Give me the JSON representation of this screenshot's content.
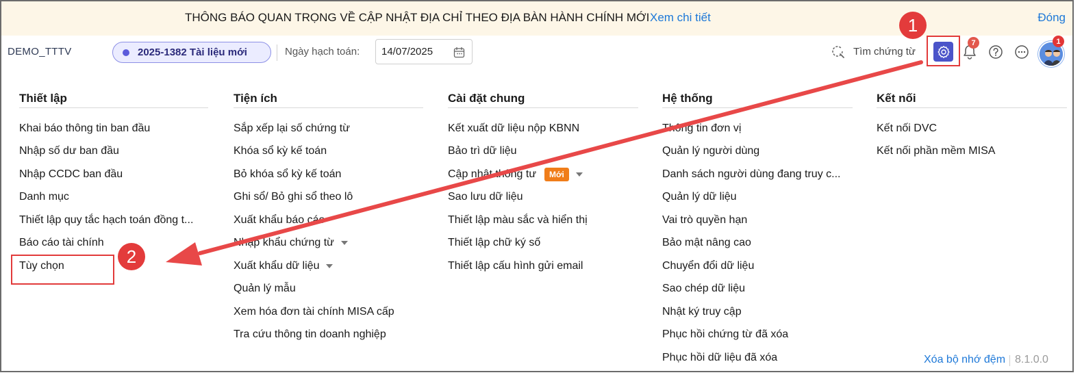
{
  "notice": {
    "text": "THÔNG BÁO QUAN TRỌNG VỀ CẬP NHẬT ĐỊA CHỈ THEO ĐỊA BÀN HÀNH CHÍNH MỚI",
    "link": "Xem chi tiết",
    "close": "Đóng"
  },
  "header": {
    "db_name": "DEMO_TTTV",
    "document": "2025-1382 Tài liệu mới",
    "date_label": "Ngày hạch toán:",
    "date_value": "14/07/2025",
    "search_label": "Tìm chứng từ",
    "notification_count": "7",
    "avatar_count": "1"
  },
  "callouts": {
    "one": "1",
    "two": "2"
  },
  "columns": [
    {
      "title": "Thiết lập",
      "items": [
        {
          "label": "Khai báo thông tin ban đầu"
        },
        {
          "label": "Nhập số dư ban đầu"
        },
        {
          "label": "Nhập CCDC ban đầu"
        },
        {
          "label": "Danh mục"
        },
        {
          "label": "Thiết lập quy tắc hạch toán đồng t..."
        },
        {
          "label": "Báo cáo tài chính"
        },
        {
          "label": "Tùy chọn"
        }
      ]
    },
    {
      "title": "Tiện ích",
      "items": [
        {
          "label": "Sắp xếp lại số chứng từ"
        },
        {
          "label": "Khóa sổ kỳ kế toán"
        },
        {
          "label": "Bỏ khóa sổ kỳ kế toán"
        },
        {
          "label": "Ghi sổ/ Bỏ ghi sổ theo lô"
        },
        {
          "label": "Xuất khẩu báo cáo"
        },
        {
          "label": "Nhập khẩu chứng từ",
          "caret": true
        },
        {
          "label": "Xuất khẩu dữ liệu",
          "caret": true
        },
        {
          "label": "Quản lý mẫu"
        },
        {
          "label": "Xem hóa đơn tài chính MISA cấp"
        },
        {
          "label": "Tra cứu thông tin doanh nghiệp"
        }
      ]
    },
    {
      "title": "Cài đặt chung",
      "items": [
        {
          "label": "Kết xuất dữ liệu nộp KBNN"
        },
        {
          "label": "Bảo trì dữ liệu"
        },
        {
          "label": "Cập nhật thông tư",
          "badge": "Mới",
          "caret": true
        },
        {
          "label": "Sao lưu dữ liệu"
        },
        {
          "label": "Thiết lập màu sắc và hiển thị"
        },
        {
          "label": "Thiết lập chữ ký số"
        },
        {
          "label": "Thiết lập cấu hình gửi email"
        }
      ]
    },
    {
      "title": "Hệ thống",
      "items": [
        {
          "label": "Thông tin đơn vị"
        },
        {
          "label": "Quản lý người dùng"
        },
        {
          "label": "Danh sách người dùng đang truy c..."
        },
        {
          "label": "Quản lý dữ liệu"
        },
        {
          "label": "Vai trò quyền hạn"
        },
        {
          "label": "Bảo mật nâng cao"
        },
        {
          "label": "Chuyển đổi dữ liệu"
        },
        {
          "label": "Sao chép dữ liệu"
        },
        {
          "label": "Nhật ký truy cập"
        },
        {
          "label": "Phục hồi chứng từ đã xóa"
        },
        {
          "label": "Phục hồi dữ liệu đã xóa"
        }
      ]
    },
    {
      "title": "Kết nối",
      "items": [
        {
          "label": "Kết nối DVC"
        },
        {
          "label": "Kết nối phần mềm MISA"
        }
      ]
    }
  ],
  "footer": {
    "clear_cache": "Xóa bộ nhớ đệm",
    "version": "8.1.0.0"
  },
  "colors": {
    "accent": "#4b54c9",
    "annotation": "#e23a3a",
    "link": "#1d78d8",
    "notice_bg": "#fdf6e7",
    "new_badge": "#f07d1a"
  }
}
